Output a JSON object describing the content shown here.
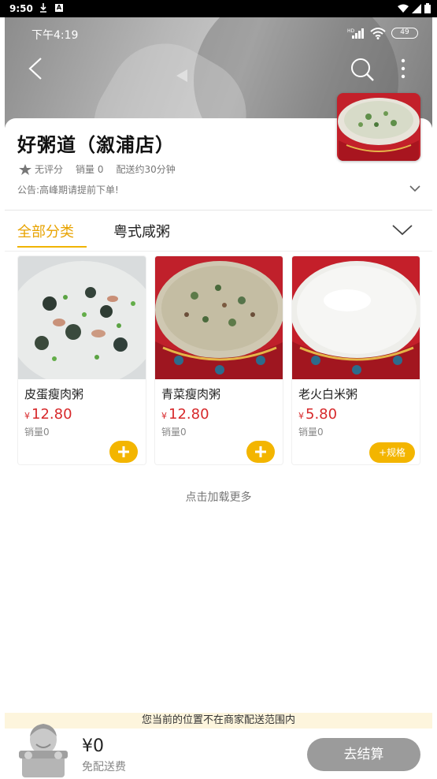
{
  "system_bar": {
    "time": "9:50"
  },
  "inner_status": {
    "time": "下午4:19",
    "battery": "49"
  },
  "shop": {
    "name": "好粥道（溆浦店）",
    "rating": "无评分",
    "sales": "销量 0",
    "delivery_time": "配送约30分钟",
    "notice": "公告:高峰期请提前下单!"
  },
  "tabs": [
    {
      "label": "全部分类",
      "active": true
    },
    {
      "label": "粤式咸粥",
      "active": false
    }
  ],
  "products": [
    {
      "name": "皮蛋瘦肉粥",
      "currency": "¥",
      "price": "12.80",
      "sales": "销量0",
      "action": "add"
    },
    {
      "name": "青菜瘦肉粥",
      "currency": "¥",
      "price": "12.80",
      "sales": "销量0",
      "action": "add"
    },
    {
      "name": "老火白米粥",
      "currency": "¥",
      "price": "5.80",
      "sales": "销量0",
      "action": "+规格"
    }
  ],
  "load_more": "点击加载更多",
  "delivery_notice": "您当前的位置不在商家配送范围内",
  "cart": {
    "total": "¥0",
    "delivery_fee": "免配送费",
    "checkout_label": "去结算"
  },
  "colors": {
    "accent": "#f3b500",
    "price": "#d7292b",
    "checkout_disabled": "#9b9b9b"
  }
}
